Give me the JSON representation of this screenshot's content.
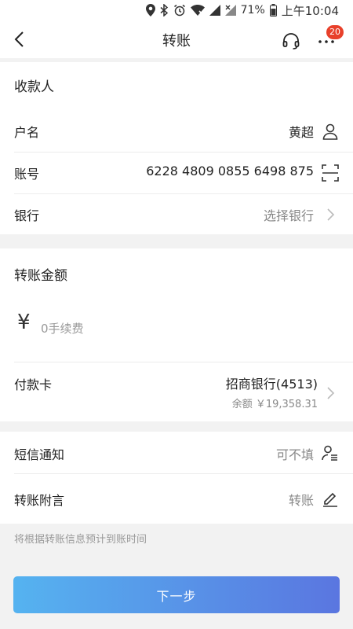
{
  "status": {
    "battery": "71%",
    "time": "上午10:04"
  },
  "nav": {
    "title": "转账",
    "badge": "20"
  },
  "payee": {
    "title": "收款人",
    "name_label": "户名",
    "name_value": "黄超",
    "account_label": "账号",
    "account_value": "6228 4809 0855 6498 875",
    "bank_label": "银行",
    "bank_value": "选择银行"
  },
  "amount": {
    "title": "转账金额",
    "currency_symbol": "¥",
    "placeholder": "0手续费",
    "card_label": "付款卡",
    "card_value": "招商银行(4513)",
    "balance": "余额 ￥19,358.31"
  },
  "extras": {
    "sms_label": "短信通知",
    "sms_value": "可不填",
    "note_label": "转账附言",
    "note_value": "转账"
  },
  "hint": "将根据转账信息预计到账时间",
  "next_button": "下一步",
  "colors": {
    "accent_start": "#55b3f0",
    "accent_end": "#5a76e0",
    "badge": "#e8402a"
  }
}
